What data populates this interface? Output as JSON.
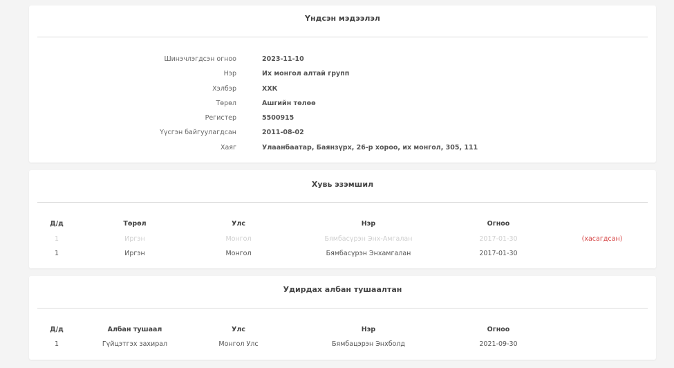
{
  "basic_info": {
    "title": "Үндсэн мэдээлэл",
    "rows": [
      {
        "label": "Шинэчлэгдсэн огноо",
        "value": "2023-11-10"
      },
      {
        "label": "Нэр",
        "value": "Их монгол алтай групп"
      },
      {
        "label": "Хэлбэр",
        "value": "ХХК"
      },
      {
        "label": "Төрөл",
        "value": "Ашгийн төлөө"
      },
      {
        "label": "Регистер",
        "value": "5500915"
      },
      {
        "label": "Үүсгэн байгуулагдсан",
        "value": "2011-08-02"
      },
      {
        "label": "Хаяг",
        "value": "Улаанбаатар, Баянзүрх, 26-р хороо, их монгол, 305, 111"
      }
    ]
  },
  "ownership": {
    "title": "Хувь эзэмшил",
    "headers": [
      "Д/д",
      "Төрөл",
      "Улс",
      "Нэр",
      "Огноо"
    ],
    "rows": [
      {
        "no": "1",
        "type": "Иргэн",
        "country": "Монгол",
        "name": "Бямбасүрэн Энх-Амгалан",
        "date": "2017-01-30",
        "status": "(хасагдсан)"
      },
      {
        "no": "1",
        "type": "Иргэн",
        "country": "Монгол",
        "name": "Бямбасүрэн Энхамгалан",
        "date": "2017-01-30",
        "status": ""
      }
    ]
  },
  "officials": {
    "title": "Удирдах албан тушаалтан",
    "headers": [
      "Д/д",
      "Албан тушаал",
      "Улс",
      "Нэр",
      "Огноо"
    ],
    "rows": [
      {
        "no": "1",
        "position": "Гүйцэтгэх захирал",
        "country": "Монгол Улс",
        "name": "Бямбацэрэн Энхболд",
        "date": "2021-09-30"
      }
    ]
  },
  "colors": {
    "removed": "#d64545",
    "faded_text": "#cfcfcf"
  }
}
